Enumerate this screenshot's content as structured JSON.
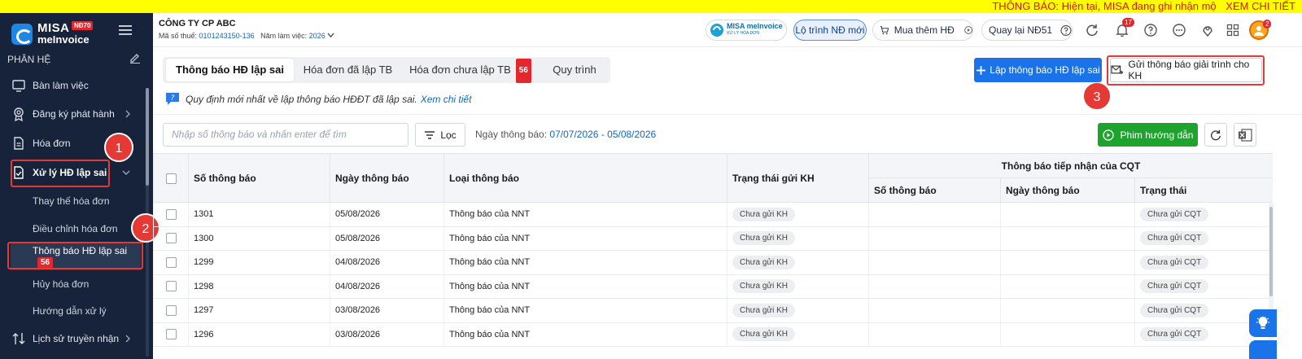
{
  "notice": {
    "text": "THÔNG BÁO: Hiện tại, MISA đang ghi nhận mộ",
    "link": "XEM CHI TIẾT"
  },
  "brand": {
    "line1": "MISA",
    "line2": "meInvoice",
    "badge": "NĐ70"
  },
  "sidebar": {
    "section": "PHÂN HỆ",
    "items": [
      {
        "label": "Bàn làm việc",
        "icon": "monitor-icon"
      },
      {
        "label": "Đăng ký phát hành",
        "icon": "badge-icon"
      },
      {
        "label": "Hóa đơn",
        "icon": "document-icon"
      },
      {
        "label": "Xử lý HĐ lập sai",
        "icon": "check-document-icon"
      }
    ],
    "subitems": [
      {
        "label": "Thay thế hóa đơn"
      },
      {
        "label": "Điều chỉnh hóa đơn"
      },
      {
        "label": "Thông báo HĐ lập sai",
        "count": "56"
      },
      {
        "label": "Hủy hóa đơn"
      },
      {
        "label": "Hướng dẫn xử lý"
      }
    ],
    "history": {
      "label": "Lịch sử truyền nhận",
      "icon": "transfer-icon"
    }
  },
  "steps": [
    "1",
    "2",
    "3"
  ],
  "topbar": {
    "company": "CÔNG TY CP ABC",
    "tax_label": "Mã số thuế:",
    "tax_value": "0101243150-136",
    "year_label": "Năm làm việc:",
    "year_value": "2026",
    "pill_brand_l1": "MISA meInvoice",
    "pill_brand_l2": "XỬ LÝ HÓA ĐƠN",
    "roadmap": "Lộ trình NĐ mới",
    "buy": "Mua thêm HĐ",
    "back": "Quay lại NĐ51",
    "bell_count": "17",
    "avatar_count": "2"
  },
  "tabs": [
    {
      "label": "Thông báo HĐ lập sai",
      "active": true
    },
    {
      "label": "Hóa đơn đã lập TB"
    },
    {
      "label": "Hóa đơn chưa lập TB",
      "count": "56"
    },
    {
      "label": "Quy trình"
    }
  ],
  "actions": {
    "create": "Lập thông báo HĐ lập sai",
    "send": "Gửi thông báo giải trình cho KH",
    "guide": "Phim hướng dẫn",
    "filter": "Lọc"
  },
  "hint": {
    "text": "Quy định mới nhất về lập thông báo HĐĐT đã lập sai.",
    "link": "Xem chi tiết"
  },
  "search": {
    "placeholder": "Nhập số thông báo và nhấn enter để tìm"
  },
  "date_filter": {
    "label": "Ngày thông báo:",
    "value": "07/07/2026 - 05/08/2026"
  },
  "table": {
    "headers": {
      "no": "Số thông báo",
      "date": "Ngày thông báo",
      "type": "Loại thông báo",
      "send_status": "Trạng thái gửi KH",
      "group": "Thông báo tiếp nhận của CQT",
      "cqt_no": "Số thông báo",
      "cqt_date": "Ngày thông báo",
      "cqt_status": "Trạng thái"
    },
    "rows": [
      {
        "no": "1301",
        "date": "05/08/2026",
        "type": "Thông báo của NNT",
        "send_status": "Chưa gửi KH",
        "cqt_status": "Chưa gửi CQT"
      },
      {
        "no": "1300",
        "date": "05/08/2026",
        "type": "Thông báo của NNT",
        "send_status": "Chưa gửi KH",
        "cqt_status": "Chưa gửi CQT"
      },
      {
        "no": "1299",
        "date": "04/08/2026",
        "type": "Thông báo của NNT",
        "send_status": "Chưa gửi KH",
        "cqt_status": "Chưa gửi CQT"
      },
      {
        "no": "1298",
        "date": "04/08/2026",
        "type": "Thông báo của NNT",
        "send_status": "Chưa gửi KH",
        "cqt_status": "Chưa gửi CQT"
      },
      {
        "no": "1297",
        "date": "03/08/2026",
        "type": "Thông báo của NNT",
        "send_status": "Chưa gửi KH",
        "cqt_status": "Chưa gửi CQT"
      },
      {
        "no": "1296",
        "date": "03/08/2026",
        "type": "Thông báo của NNT",
        "send_status": "Chưa gửi KH",
        "cqt_status": "Chưa gửi CQT"
      }
    ]
  },
  "colors": {
    "primary": "#1a73e8",
    "sidebar": "#16233a",
    "accent_red": "#e53935",
    "green": "#1fa32f",
    "notice": "#ffff00"
  }
}
